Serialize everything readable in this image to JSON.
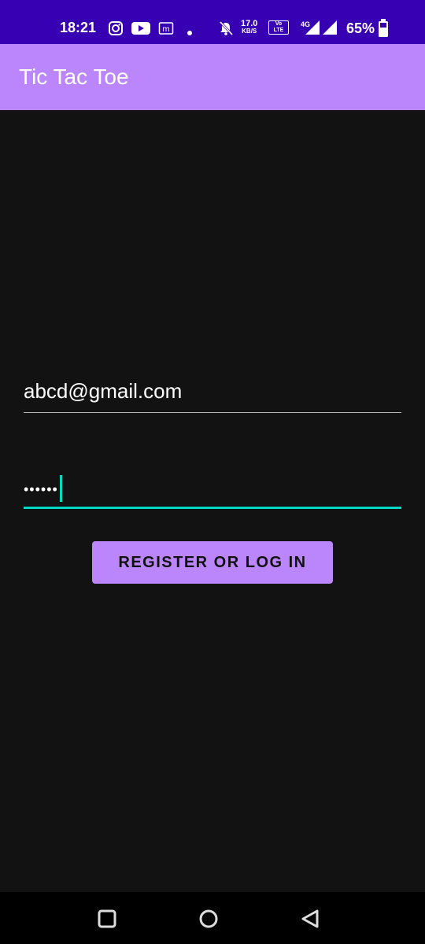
{
  "status_bar": {
    "time": "18:21",
    "speed_value": "17.0",
    "speed_unit": "KB/S",
    "volte_top": "Vo",
    "volte_bottom": "LTE",
    "network": "4G",
    "battery": "65%",
    "icons": [
      "instagram-icon",
      "youtube-icon",
      "m-app-icon",
      "dot-icon",
      "mute-bell-icon",
      "signal-icon",
      "battery-icon"
    ]
  },
  "app_bar": {
    "title": "Tic Tac Toe",
    "color": "#BB86FC"
  },
  "form": {
    "email_value": "abcd@gmail.com",
    "password_value": "••••••",
    "accent": "#03DAC5"
  },
  "actions": {
    "register_label": "REGISTER OR LOG IN"
  },
  "nav_bar": {
    "icons": [
      "recents-icon",
      "home-icon",
      "back-icon"
    ]
  }
}
